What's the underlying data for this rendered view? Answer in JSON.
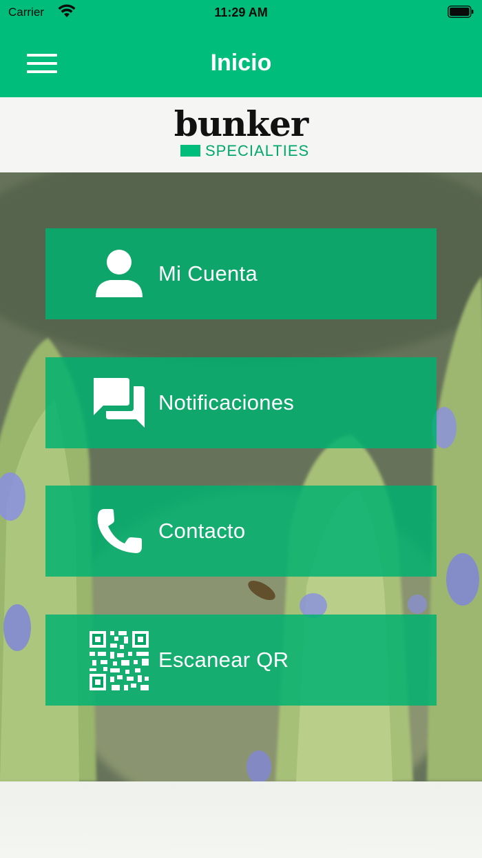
{
  "status_bar": {
    "carrier": "Carrier",
    "time": "11:29 AM"
  },
  "header": {
    "title": "Inicio",
    "menu_icon": "hamburger-menu-icon"
  },
  "logo": {
    "wordmark": "bunker",
    "subtitle": "SPECIALTIES"
  },
  "menu": {
    "items": [
      {
        "label": "Mi Cuenta",
        "icon": "person-icon"
      },
      {
        "label": "Notificaciones",
        "icon": "chat-bubbles-icon"
      },
      {
        "label": "Contacto",
        "icon": "phone-icon"
      },
      {
        "label": "Escanear QR",
        "icon": "qr-code-icon"
      }
    ]
  },
  "colors": {
    "brand_green": "#00bd7b",
    "tile_green": "#00b270",
    "text_white": "#ffffff"
  }
}
